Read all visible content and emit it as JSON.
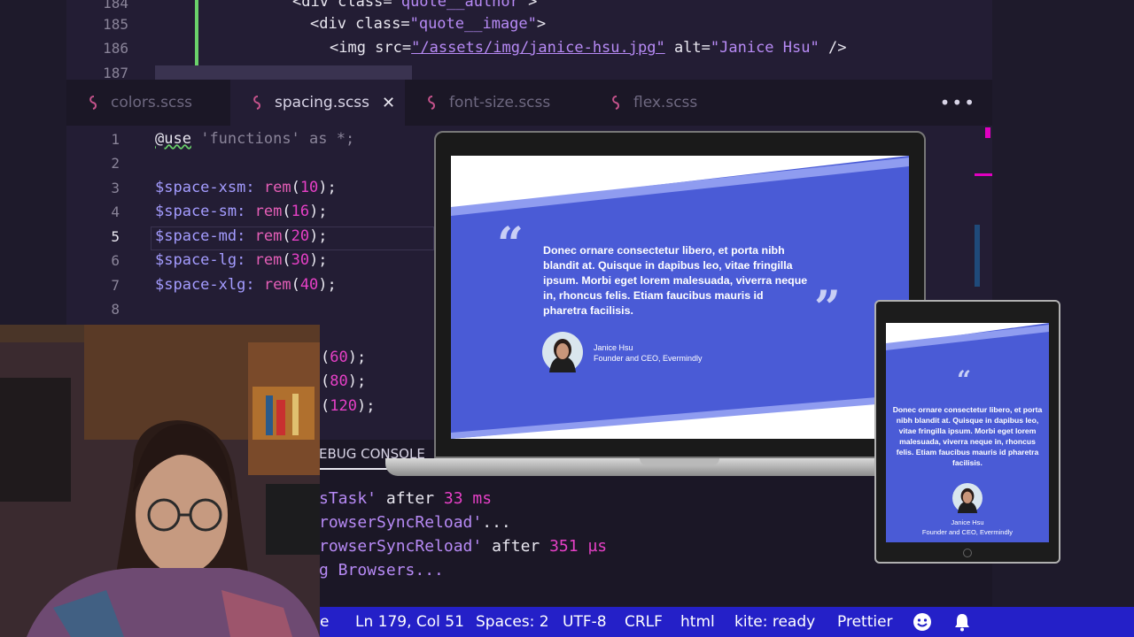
{
  "top_code": {
    "lines": [
      {
        "num": "184",
        "text_a": "<div class=",
        "text_b": "\"quote__author\"",
        "text_c": ">"
      },
      {
        "num": "185",
        "text_a": "<div class=",
        "text_b": "\"quote__image\"",
        "text_c": ">"
      },
      {
        "num": "186",
        "text_a": "<img src=",
        "text_b": "\"/assets/img/janice-hsu.jpg\"",
        "text_c": " alt=",
        "text_d": "\"Janice Hsu\"",
        "text_e": " />"
      },
      {
        "num": "187"
      }
    ]
  },
  "tabs": [
    {
      "label": "colors.scss"
    },
    {
      "label": "spacing.scss",
      "close": "✕"
    },
    {
      "label": "font-size.scss"
    },
    {
      "label": "flex.scss"
    }
  ],
  "tabs_more": "•••",
  "editor": {
    "line_numbers": [
      "1",
      "2",
      "3",
      "4",
      "5",
      "6",
      "7",
      "8"
    ],
    "line1": {
      "kw": "@use",
      "str": "'functions'",
      "rest": " as *;"
    },
    "vars": [
      {
        "name": "$space-xsm",
        "fn": "rem",
        "val": "10"
      },
      {
        "name": "$space-sm",
        "fn": "rem",
        "val": "16"
      },
      {
        "name": "$space-md",
        "fn": "rem",
        "val": "20"
      },
      {
        "name": "$space-lg",
        "fn": "rem",
        "val": "30"
      },
      {
        "name": "$space-xlg",
        "fn": "rem",
        "val": "40"
      }
    ],
    "partial_lines": [
      {
        "val": "60",
        "tail": ");"
      },
      {
        "val": "80",
        "tail": ");"
      },
      {
        "val": "120",
        "tail": ");"
      }
    ]
  },
  "terminal": {
    "header": "EBUG CONSOLE",
    "lines": [
      {
        "a": "sTask'",
        "b": " after ",
        "c": "33",
        "d": " ms"
      },
      {
        "a": "rowserSyncReload'",
        "b": "..."
      },
      {
        "a": "rowserSyncReload'",
        "b": " after ",
        "c": "351",
        "d": " µs"
      },
      {
        "a": "g Browsers..."
      }
    ]
  },
  "status_bar": {
    "partial": "e",
    "position": "Ln 179, Col 51",
    "spaces": "Spaces: 2",
    "encoding": "UTF-8",
    "eol": "CRLF",
    "language": "html",
    "kite": "kite: ready",
    "formatter": "Prettier"
  },
  "quote": {
    "text": "Donec ornare consectetur libero, et porta nibh blandit at. Quisque in dapibus leo, vitae fringilla ipsum. Morbi eget lorem malesuada, viverra neque in, rhoncus felis. Etiam faucibus mauris id pharetra facilisis.",
    "name": "Janice Hsu",
    "role": "Founder and CEO, Evermindly",
    "open_mark": "“",
    "close_mark": "”"
  },
  "colors": {
    "accent": "#4a5bd6",
    "accent_light": "#8f9cf0",
    "status_bar": "#2420c8",
    "editor_bg": "#231d34"
  }
}
